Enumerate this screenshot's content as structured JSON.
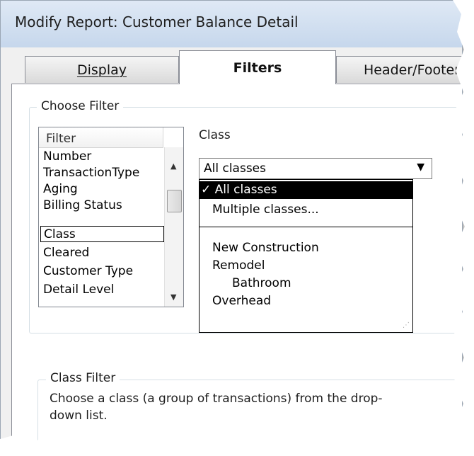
{
  "window": {
    "title": "Modify Report: Customer Balance Detail"
  },
  "tabs": [
    {
      "label": "Display",
      "active": false
    },
    {
      "label": "Filters",
      "active": true
    },
    {
      "label": "Header/Footer",
      "active": false
    }
  ],
  "choose_filter": {
    "group_label": "Choose Filter",
    "list_header": "Filter",
    "items": [
      "Number",
      "TransactionType",
      "Aging",
      "Billing Status",
      "Class",
      "Cleared",
      "Customer Type",
      "Detail Level"
    ],
    "selected": "Class"
  },
  "class": {
    "label": "Class",
    "value": "All classes",
    "options": [
      "All classes",
      "Multiple classes...",
      "New Construction",
      "Remodel",
      "Bathroom",
      "Overhead"
    ],
    "checkmark": "✓"
  },
  "class_filter": {
    "group_label": "Class Filter",
    "description": "Choose a class (a group of transactions) from the drop-down list."
  }
}
